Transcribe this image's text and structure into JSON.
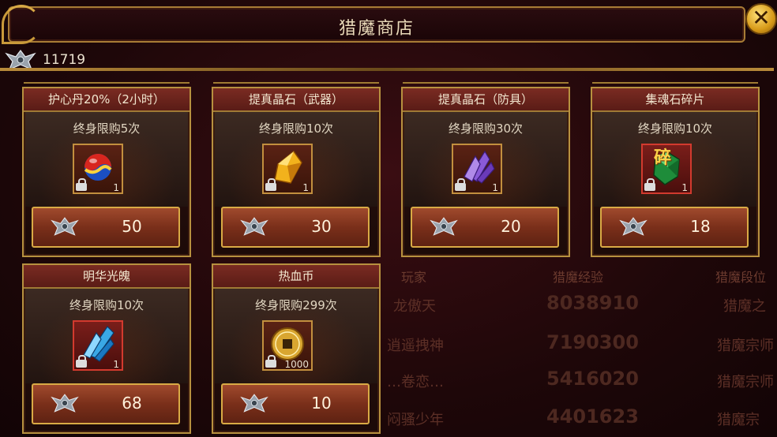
{
  "shop": {
    "title": "猎魔商店",
    "currency": {
      "value": "11719",
      "icon": "demon-hunt-emblem-icon"
    },
    "close_icon": "close-icon",
    "items": [
      {
        "name": "护心丹20%（2小时）",
        "limit": "终身限购5次",
        "quantity": "1",
        "price": "50",
        "icon": "red-blue-orb-icon",
        "frame": "gold"
      },
      {
        "name": "提真晶石（武器）",
        "limit": "终身限购10次",
        "quantity": "1",
        "price": "30",
        "icon": "gold-crystal-icon",
        "frame": "gold"
      },
      {
        "name": "提真晶石（防具）",
        "limit": "终身限购30次",
        "quantity": "1",
        "price": "20",
        "icon": "purple-crystal-icon",
        "frame": "gold"
      },
      {
        "name": "集魂石碎片",
        "limit": "终身限购10次",
        "quantity": "1",
        "price": "18",
        "icon": "green-soul-stone-icon",
        "frame": "red",
        "badge": "碎"
      },
      {
        "name": "明华光魄",
        "limit": "终身限购10次",
        "quantity": "1",
        "price": "68",
        "icon": "blue-crystal-icon",
        "frame": "red"
      },
      {
        "name": "热血币",
        "limit": "终身限购299次",
        "quantity": "1000",
        "price": "10",
        "icon": "gold-coin-icon",
        "frame": "gold"
      }
    ]
  },
  "background_ranking": {
    "headers": [
      "玩家",
      "猎魔经验",
      "猎魔段位"
    ],
    "rows": [
      {
        "player": "龙傲天",
        "exp": "8038910",
        "rank": "猎魔之"
      },
      {
        "player": "逍遥拽神",
        "exp": "7190300",
        "rank": "猎魔宗师"
      },
      {
        "player": "…卷恋…",
        "exp": "5416020",
        "rank": "猎魔宗师"
      },
      {
        "player": "闷骚少年",
        "exp": "4401623",
        "rank": "猎魔宗"
      }
    ]
  }
}
